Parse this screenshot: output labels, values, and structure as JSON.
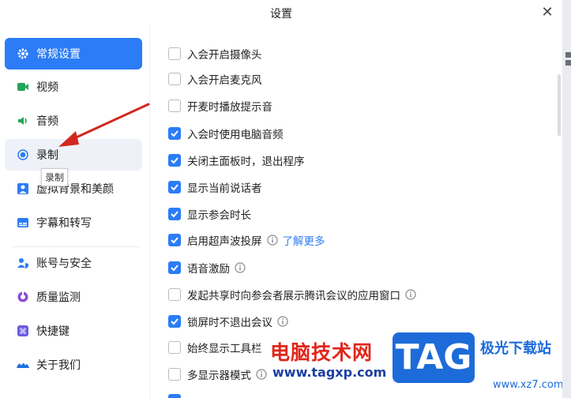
{
  "window": {
    "title": "设置",
    "close_glyph": "✕"
  },
  "sidebar": {
    "items": [
      {
        "label": "常规设置",
        "icon": "gear-icon",
        "active": true
      },
      {
        "label": "视频",
        "icon": "video-camera-icon"
      },
      {
        "label": "音频",
        "icon": "speaker-icon"
      },
      {
        "label": "录制",
        "icon": "record-icon",
        "hover": true
      },
      {
        "label": "虚拟背景和美颜",
        "icon": "portrait-icon"
      },
      {
        "label": "字幕和转写",
        "icon": "subtitle-icon"
      },
      {
        "label": "账号与安全",
        "icon": "account-security-icon"
      },
      {
        "label": "质量监测",
        "icon": "quality-monitor-icon"
      },
      {
        "label": "快捷键",
        "icon": "keyboard-shortcut-icon"
      },
      {
        "label": "关于我们",
        "icon": "about-icon"
      }
    ],
    "tooltip": "录制"
  },
  "options": [
    {
      "label": "入会开启摄像头",
      "checked": false
    },
    {
      "label": "入会开启麦克风",
      "checked": false
    },
    {
      "label": "开麦时播放提示音",
      "checked": false
    },
    {
      "label": "入会时使用电脑音频",
      "checked": true
    },
    {
      "label": "关闭主面板时，退出程序",
      "checked": true
    },
    {
      "label": "显示当前说话者",
      "checked": true
    },
    {
      "label": "显示参会时长",
      "checked": true
    },
    {
      "label": "启用超声波投屏",
      "checked": true,
      "info": true,
      "link": "了解更多"
    },
    {
      "label": "语音激励",
      "checked": true,
      "info": true
    },
    {
      "label": "发起共享时向参会者展示腾讯会议的应用窗口",
      "checked": false,
      "info": true
    },
    {
      "label": "锁屏时不退出会议",
      "checked": true,
      "info": true
    },
    {
      "label": "始终显示工具栏",
      "checked": false
    },
    {
      "label": "多显示器模式",
      "checked": false,
      "info": true
    }
  ],
  "watermark": {
    "cn": "电脑技术网",
    "url": "www.tagxp.com",
    "tag": "TAG",
    "site": "极光下载站",
    "site2": "www.xz7.com"
  },
  "colors": {
    "accent": "#2b7cf6",
    "arrow": "#d0281f"
  }
}
